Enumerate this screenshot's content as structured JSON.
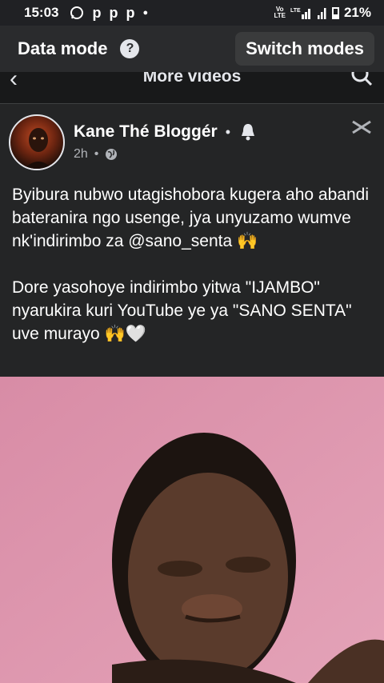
{
  "status_bar": {
    "time": "15:03",
    "notif_icons": [
      "whatsapp-icon",
      "p",
      "p",
      "p"
    ],
    "network": "Vo LTE",
    "battery": "21%"
  },
  "data_mode": {
    "title": "Data mode",
    "help": "?",
    "switch_label": "Switch modes"
  },
  "sub_header": {
    "title": "More videos"
  },
  "post": {
    "author": "Kane Thé Bloggér",
    "time": "2h",
    "text": "Byibura nubwo utagishobora kugera aho abandi bateranira ngo usenge, jya unyuzamo wumve nk'indirimbo za @sano_senta 🙌\n\nDore yasohoye indirimbo yitwa \"IJAMBO\" nyarukira kuri YouTube ye ya \"SANO SENTA\" uve murayo 🙌🤍"
  },
  "colors": {
    "background": "#242526",
    "header": "#2a2b2d",
    "text": "#ffffff",
    "muted": "#b0b3b8"
  }
}
